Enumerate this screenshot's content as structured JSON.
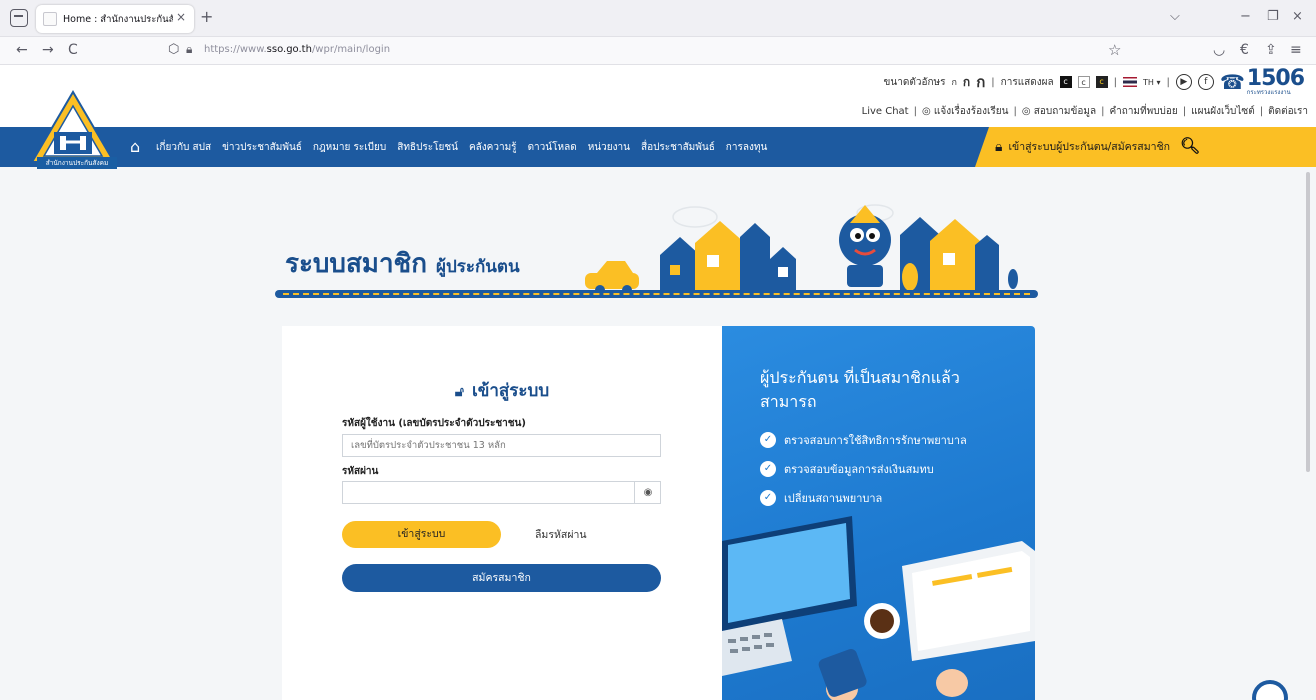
{
  "browser": {
    "tab_title": "Home : สำนักงานประกันสังคม",
    "tab_close": "×",
    "new_tab": "+",
    "back": "←",
    "forward": "→",
    "reload": "C",
    "url_prefix": "https://www.",
    "url_domain": "sso.go.th",
    "url_path": "/wpr/main/login",
    "bookmark_star": "☆",
    "win_minimize": "−",
    "win_restore": "❐",
    "win_close": "×",
    "win_chevron": "⌵",
    "pocket": "◡",
    "ext": "€",
    "share": "⇪",
    "menu": "≡"
  },
  "utility": {
    "font_size_label": "ขนาดตัวอักษร",
    "font_small": "ก",
    "font_mid": "ก",
    "font_big": "ก",
    "display_label": "การแสดงผล",
    "contrast_a": "c",
    "contrast_b": "c",
    "contrast_c": "c",
    "lang": "TH",
    "lang_caret": "▾",
    "youtube": "▶",
    "facebook": "f",
    "hotline_number": "1506",
    "hotline_sub": "กระทรวงแรงงาน",
    "live_chat": "Live Chat",
    "complaint": "แจ้งเรื่องร้องเรียน",
    "ask": "สอบถามข้อมูล",
    "faq": "คำถามที่พบบ่อย",
    "sitemap": "แผนผังเว็บไซต์",
    "contact": "ติดต่อเรา"
  },
  "logo": {
    "caption": "สำนักงานประกันสังคม"
  },
  "menu": {
    "items": [
      "เกี่ยวกับ สปส",
      "ข่าวประชาสัมพันธ์",
      "กฎหมาย ระเบียบ",
      "สิทธิประโยชน์",
      "คลังความรู้",
      "ดาวน์โหลด",
      "หน่วยงาน",
      "สื่อประชาสัมพันธ์",
      "การลงทุน"
    ],
    "login_link": "เข้าสู่ระบบผู้ประกันตน/สมัครสมาชิก"
  },
  "banner": {
    "title": "ระบบสมาชิก",
    "subtitle": "ผู้ประกันตน"
  },
  "login": {
    "title": "เข้าสู่ระบบ",
    "username_label": "รหัสผู้ใช้งาน (เลขบัตรประจำตัวประชาชน)",
    "username_placeholder": "เลขที่บัตรประจำตัวประชาชน 13 หลัก",
    "username_value": "",
    "password_label": "รหัสผ่าน",
    "password_value": "",
    "login_button": "เข้าสู่ระบบ",
    "forgot_password": "ลืมรหัสผ่าน",
    "register_button": "สมัครสมาชิก"
  },
  "info": {
    "title": "ผู้ประกันตน ที่เป็นสมาชิกแล้ว สามารถ",
    "items": [
      "ตรวจสอบการใช้สิทธิการรักษาพยาบาล",
      "ตรวจสอบข้อมูลการส่งเงินสมทบ",
      "เปลี่ยนสถานพยาบาล"
    ]
  },
  "colors": {
    "brand_blue": "#1d5aa0",
    "brand_yellow": "#fbbf24",
    "info_blue": "#2b8ce0"
  }
}
